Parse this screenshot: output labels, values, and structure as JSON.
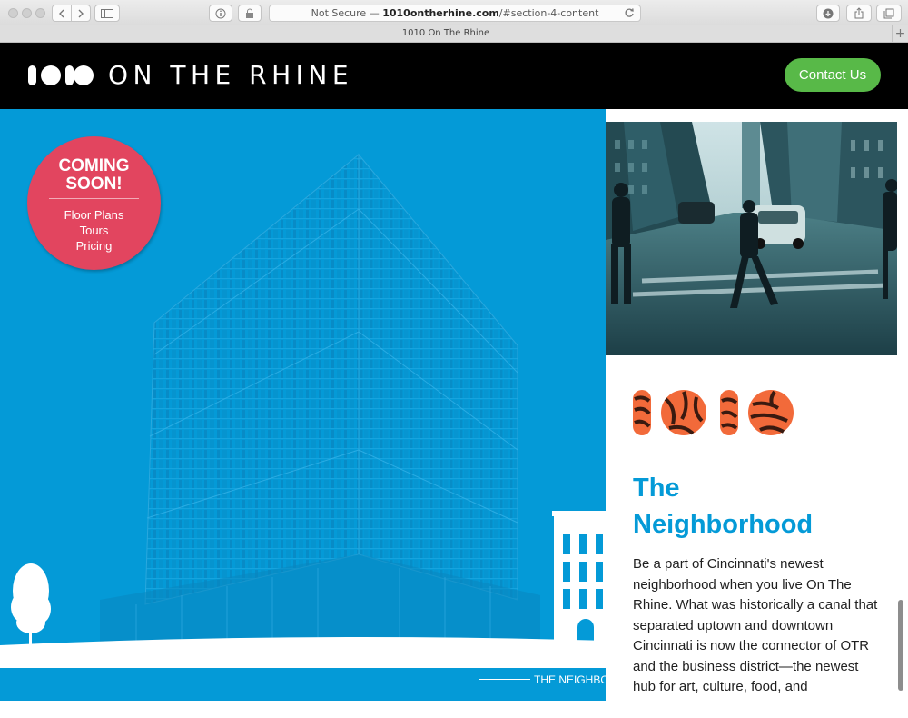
{
  "browser": {
    "security": "Not Secure",
    "separator": "—",
    "domain": "1010ontherhine.com",
    "path": "/#section-4-content",
    "tab_title": "1010 On The Rhine",
    "new_tab_symbol": "+"
  },
  "header": {
    "logo_digits": "1010",
    "logo_word": "ON THE RHINE",
    "contact_label": "Contact Us"
  },
  "badge": {
    "title_line1": "COMING",
    "title_line2": "SOON!",
    "links": [
      "Floor Plans",
      "Tours",
      "Pricing"
    ]
  },
  "hero": {
    "section_label": "THE NEIGHBORHOOD"
  },
  "neighborhood": {
    "title_line1": "The",
    "title_line2": "Neighborhood",
    "body": "Be a part of Cincinnati's newest neighborhood when you live On The Rhine. What was historically a canal that separated uptown and downtown Cincinnati is now the connector of OTR and the business district—the newest hub for art, culture, food, and"
  },
  "colors": {
    "brand_blue": "#049ad7",
    "contact_green": "#58b948",
    "badge_red": "#e2455f",
    "tiger_orange": "#f26a3a"
  }
}
